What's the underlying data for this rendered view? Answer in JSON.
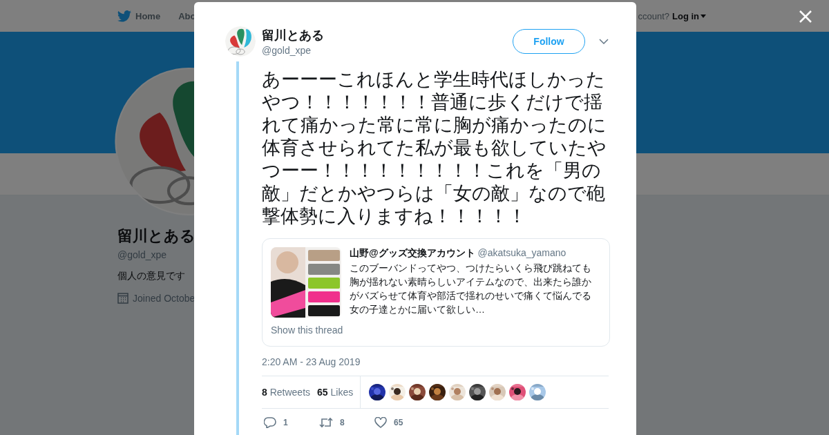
{
  "nav": {
    "items": [
      {
        "label": "Home"
      },
      {
        "label": "Abo"
      }
    ],
    "account_prompt": "ccount?",
    "login": "Log in"
  },
  "profile": {
    "name": "留川とある",
    "handle": "@gold_xpe",
    "bio": "個人の意見です",
    "joined": "Joined Octobe"
  },
  "tweet": {
    "author": "留川とある",
    "handle": "@gold_xpe",
    "follow": "Follow",
    "text": "あーーーこれほんと学生時代ほしかったやつ！！！！！！！普通に歩くだけで揺れて痛かった常に常に胸が痛かったのに体育させられてた私が最も欲していたやつーー！！！！！！！！！これを「男の敵」だとかやつらは「女の敵」なので砲撃体勢に入りますね！！！！！",
    "quote": {
      "author": "山野@グッズ交換アカウント",
      "handle": "@akatsuka_yamano",
      "text": "このブーバンドってやつ、つけたらいくら飛び跳ねても胸が揺れない素晴らしいアイテムなので、出来たら誰かがバズらせて体育や部活で揺れのせいで痛くて悩んでる女の子達とかに届いて欲しい…",
      "show_thread": "Show this thread"
    },
    "timestamp": "2:20 AM - 23 Aug 2019",
    "stats": [
      {
        "count": "8",
        "label": "Retweets"
      },
      {
        "count": "65",
        "label": "Likes"
      }
    ],
    "actions": [
      {
        "kind": "reply",
        "count": "1"
      },
      {
        "kind": "retweet",
        "count": "8"
      },
      {
        "kind": "like",
        "count": "65"
      }
    ]
  }
}
